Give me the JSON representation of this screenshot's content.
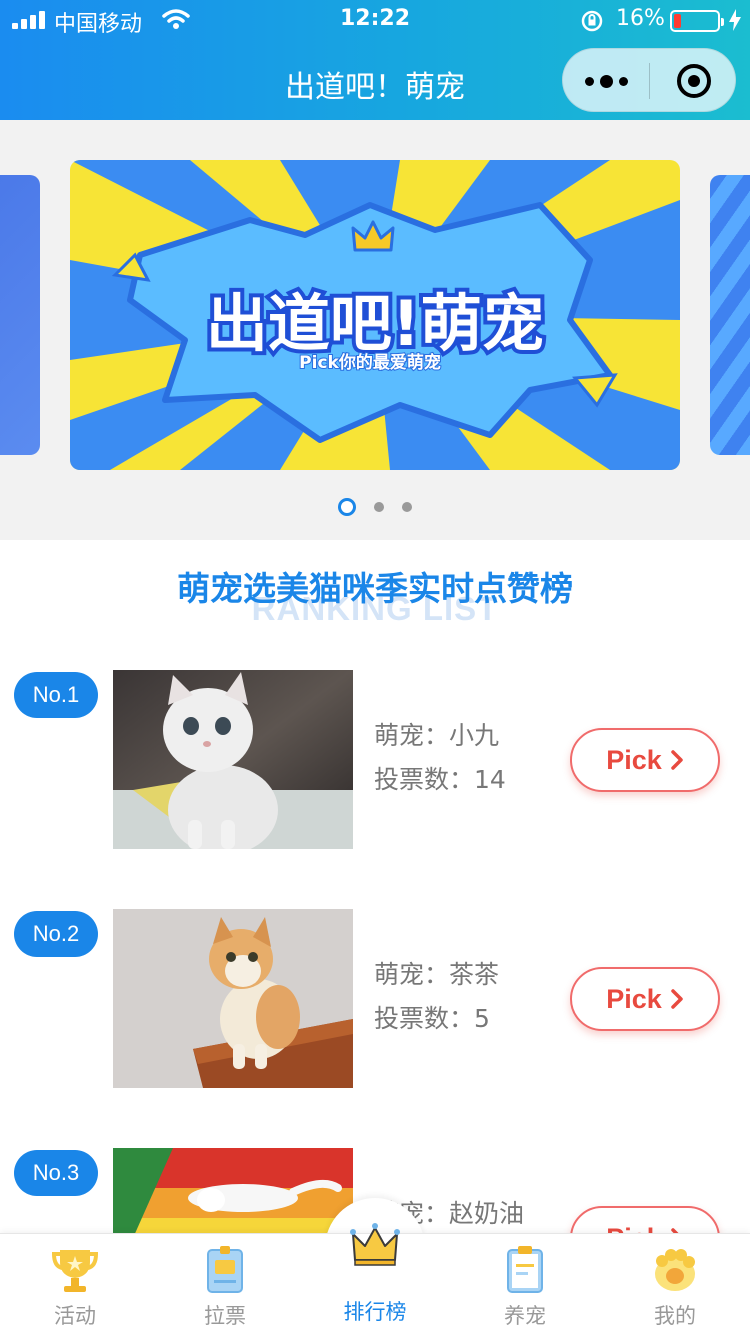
{
  "status_bar": {
    "carrier": "中国移动",
    "time": "12:22",
    "battery_percent": "16%",
    "battery_level": 0.16
  },
  "nav": {
    "title": "出道吧！萌宠"
  },
  "banner": {
    "headline": "出道吧!萌宠",
    "tagline": "Pick你的最爱萌宠",
    "slides": 3,
    "active_slide": 1
  },
  "ranking": {
    "title": "萌宠选美猫咪季实时点赞榜",
    "subtitle": "RANKING LIST",
    "items": [
      {
        "rank": "No.1",
        "pet": "萌宠：小九",
        "votes": "投票数：14",
        "pick": "Pick"
      },
      {
        "rank": "No.2",
        "pet": "萌宠：茶茶",
        "votes": "投票数：5",
        "pick": "Pick"
      },
      {
        "rank": "No.3",
        "pet": "萌宠：赵奶油",
        "votes": "",
        "pick": "Pick"
      }
    ]
  },
  "tabbar": {
    "tabs": [
      {
        "label": "活动",
        "icon": "trophy-icon"
      },
      {
        "label": "拉票",
        "icon": "badge-card-icon"
      },
      {
        "label": "排行榜",
        "icon": "crown-icon",
        "active": true
      },
      {
        "label": "养宠",
        "icon": "clipboard-icon"
      },
      {
        "label": "我的",
        "icon": "paw-icon"
      }
    ]
  },
  "colors": {
    "primary": "#1a86e8",
    "pick": "#e84a3f"
  }
}
